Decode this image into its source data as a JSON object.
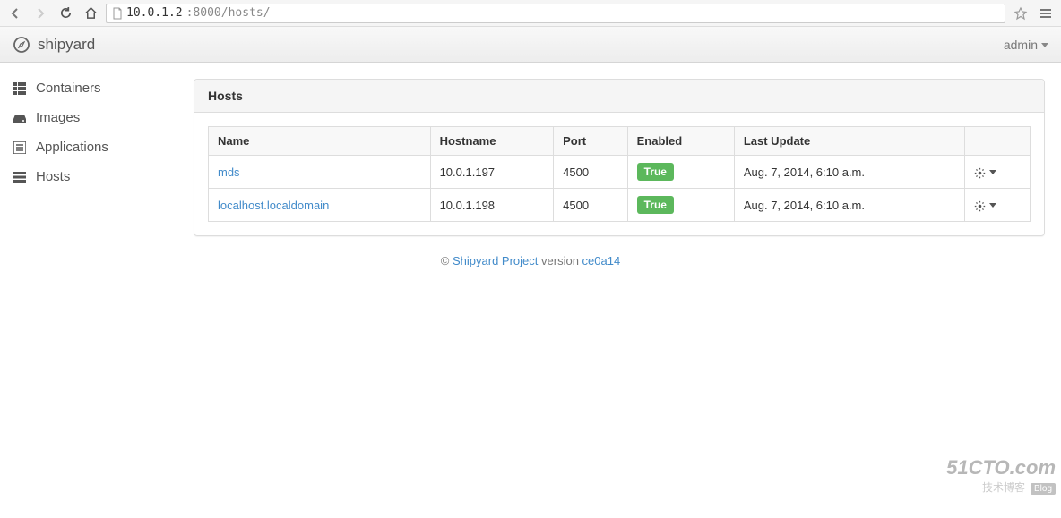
{
  "browser": {
    "url_prefix": "10.0.1.2",
    "url_rest": ":8000/hosts/"
  },
  "topbar": {
    "brand": "shipyard",
    "user": "admin"
  },
  "sidebar": {
    "items": [
      {
        "label": "Containers"
      },
      {
        "label": "Images"
      },
      {
        "label": "Applications"
      },
      {
        "label": "Hosts"
      }
    ]
  },
  "panel": {
    "title": "Hosts"
  },
  "table": {
    "headers": {
      "name": "Name",
      "hostname": "Hostname",
      "port": "Port",
      "enabled": "Enabled",
      "last_update": "Last Update"
    },
    "rows": [
      {
        "name": "mds",
        "hostname": "10.0.1.197",
        "port": "4500",
        "enabled": "True",
        "last_update": "Aug. 7, 2014, 6:10 a.m."
      },
      {
        "name": "localhost.localdomain",
        "hostname": "10.0.1.198",
        "port": "4500",
        "enabled": "True",
        "last_update": "Aug. 7, 2014, 6:10 a.m."
      }
    ]
  },
  "footer": {
    "copyright": "©",
    "link_text": "Shipyard Project",
    "version_label": " version ",
    "version": "ce0a14"
  },
  "watermark": {
    "big": "51CTO.com",
    "small": "技术博客",
    "blog": "Blog"
  }
}
